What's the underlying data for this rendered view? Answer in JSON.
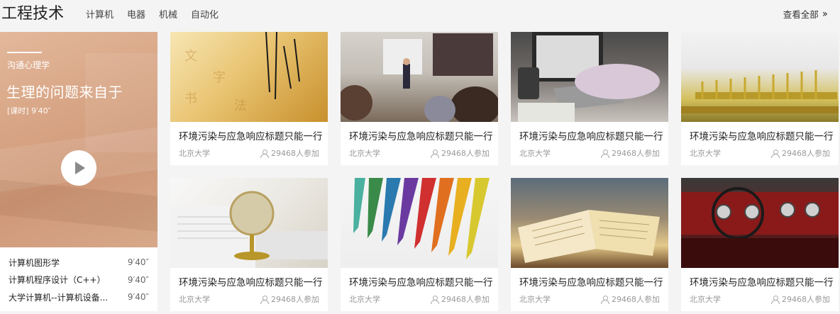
{
  "header": {
    "title": "工程技术",
    "tabs": [
      "计算机",
      "电器",
      "机械",
      "自动化"
    ],
    "more_label": "查看全部",
    "more_icon": "double-chevron-right-icon"
  },
  "feature": {
    "category": "沟通心理学",
    "title": "生理的问题来自于",
    "meta": "[课时] 9′40″",
    "play_icon": "play-icon",
    "colors": {
      "overlay": "#d8a686"
    },
    "lessons": [
      {
        "name": "计算机图形学",
        "duration": "9′40″"
      },
      {
        "name": "计算机程序设计（C++）",
        "duration": "9′40″"
      },
      {
        "name": "大学计算机--计算机设备...",
        "duration": "9′40″"
      }
    ]
  },
  "courses": [
    {
      "title": "环境污染与应急响应标题只能一行",
      "school": "北京大学",
      "count": "29468人参加",
      "image": "acupuncture-needles"
    },
    {
      "title": "环境污染与应急响应标题只能一行",
      "school": "北京大学",
      "count": "29468人参加",
      "image": "classroom-lecture"
    },
    {
      "title": "环境污染与应急响应标题只能一行",
      "school": "北京大学",
      "count": "29468人参加",
      "image": "laptop-typing"
    },
    {
      "title": "环境污染与应急响应标题只能一行",
      "school": "北京大学",
      "count": "29468人参加",
      "image": "circuit-pins"
    },
    {
      "title": "环境污染与应急响应标题只能一行",
      "school": "北京大学",
      "count": "29468人参加",
      "image": "globe-newspaper"
    },
    {
      "title": "环境污染与应急响应标题只能一行",
      "school": "北京大学",
      "count": "29468人参加",
      "image": "color-pencils"
    },
    {
      "title": "环境污染与应急响应标题只能一行",
      "school": "北京大学",
      "count": "29468人参加",
      "image": "open-book"
    },
    {
      "title": "环境污染与应急响应标题只能一行",
      "school": "北京大学",
      "count": "29468人参加",
      "image": "vintage-car-dashboard"
    }
  ]
}
